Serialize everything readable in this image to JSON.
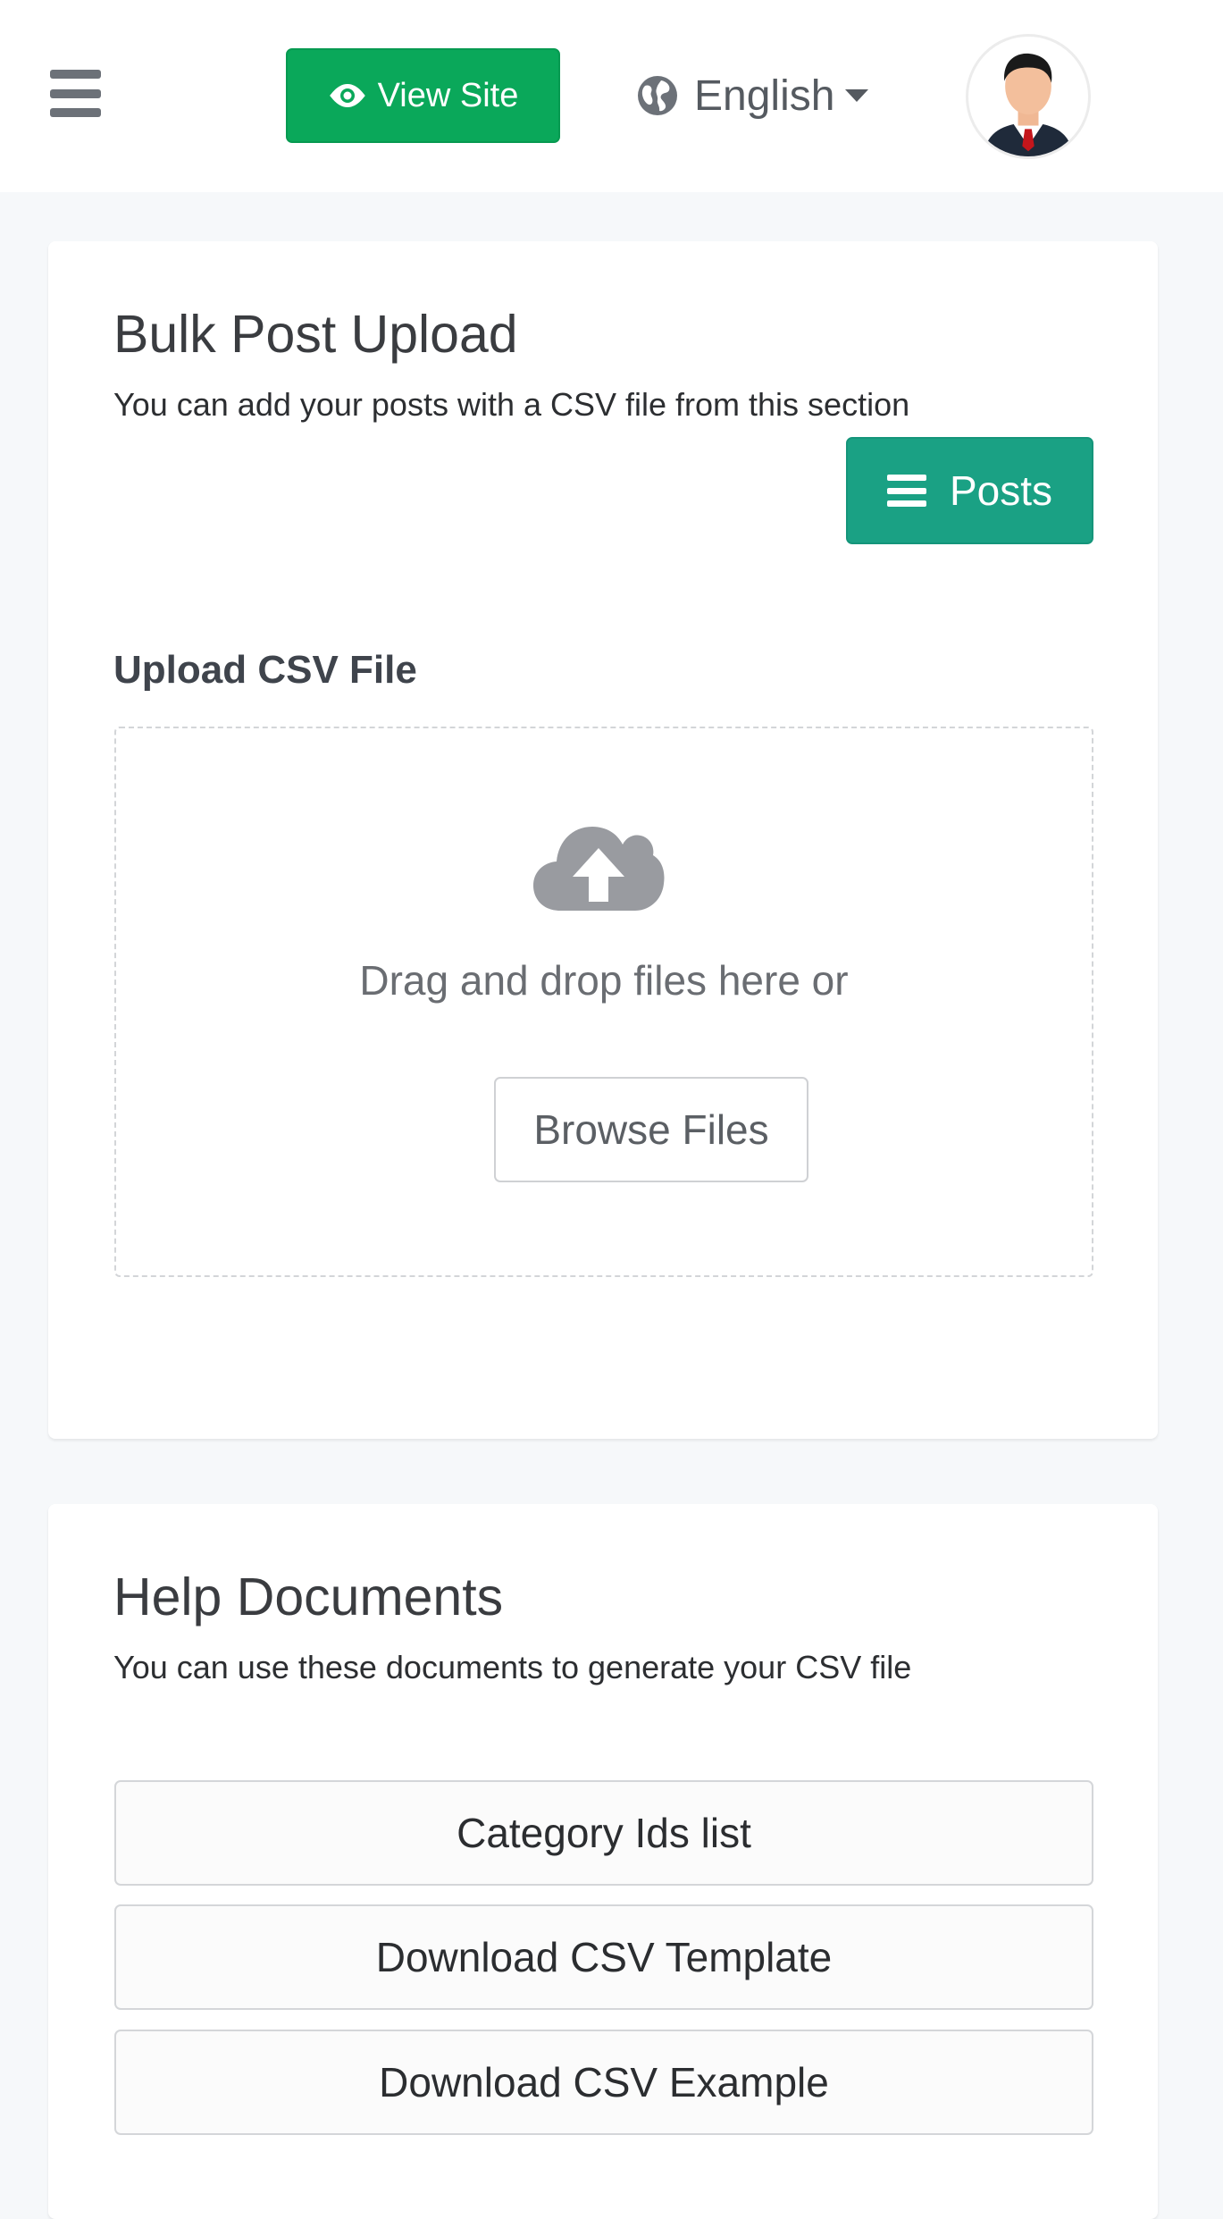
{
  "header": {
    "view_site_label": "View Site",
    "language": "English"
  },
  "bulk_upload": {
    "title": "Bulk Post Upload",
    "subtitle": "You can add your posts with a CSV file from this section",
    "posts_button": "Posts",
    "upload_label": "Upload CSV File",
    "drop_text": "Drag and drop files here or",
    "browse_button": "Browse Files"
  },
  "help_docs": {
    "title": "Help Documents",
    "subtitle": "You can use these documents to generate your CSV file",
    "buttons": [
      {
        "label": "Category Ids list"
      },
      {
        "label": "Download CSV Template"
      },
      {
        "label": "Download CSV Example"
      }
    ]
  },
  "colors": {
    "view_site_green": "#0aa85a",
    "posts_teal": "#1aa184",
    "page_background": "#f6f8fa"
  },
  "icons": [
    "menu-icon",
    "eye-icon",
    "globe-icon",
    "caret-down-icon",
    "list-icon",
    "cloud-upload-icon"
  ]
}
